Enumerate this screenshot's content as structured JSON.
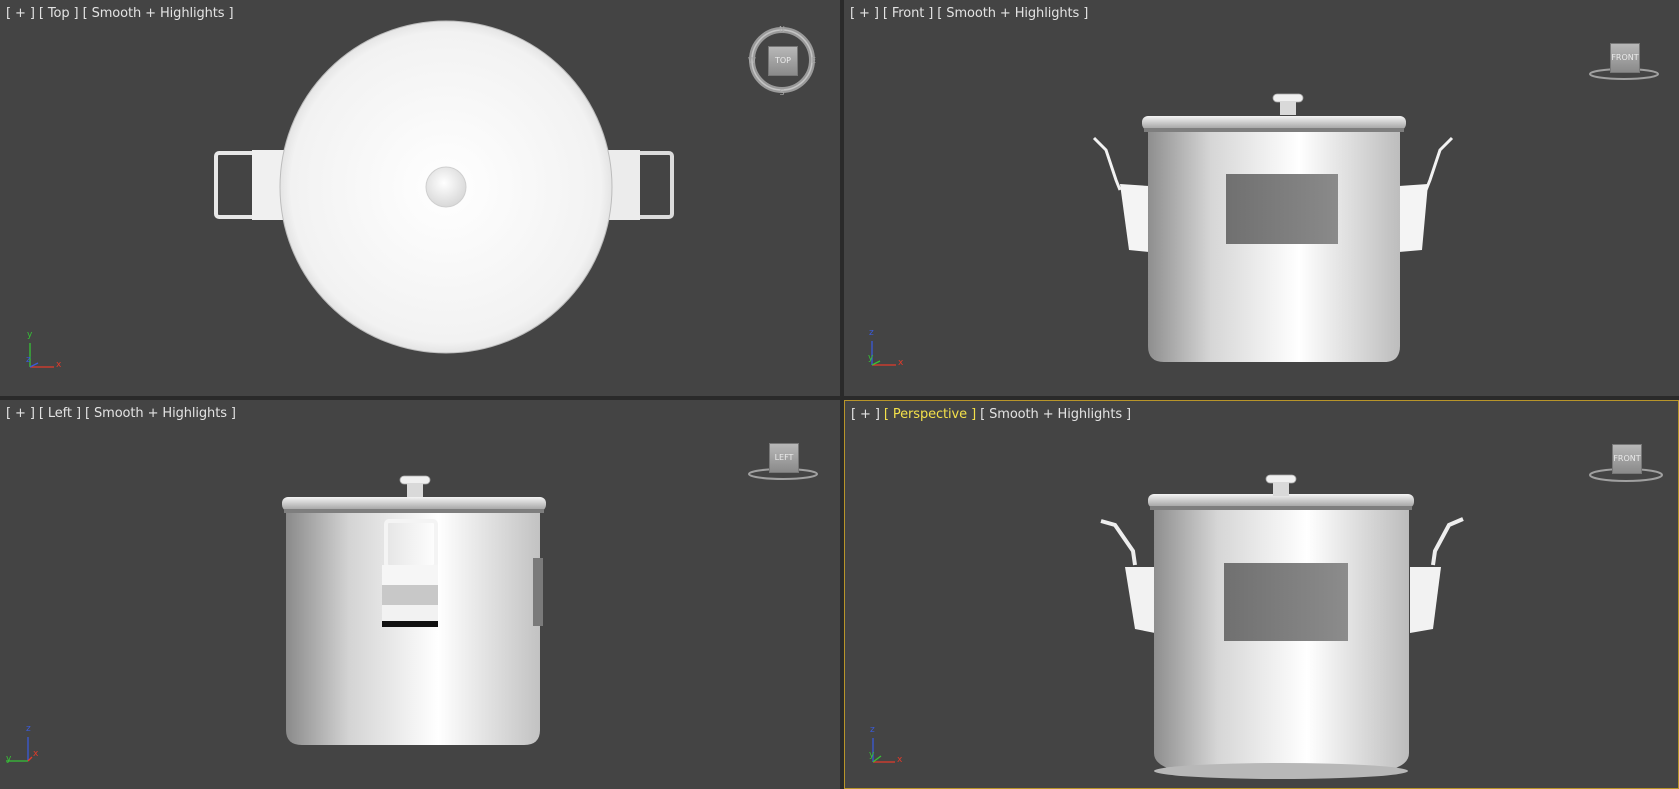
{
  "viewports": [
    {
      "id": "top",
      "menu": "[ + ]",
      "view": "[ Top ]",
      "shading": "[ Smooth + Highlights ]",
      "viewcube": {
        "face": "TOP",
        "compass": [
          "N",
          "E",
          "S",
          "W"
        ]
      },
      "axes": [
        "y",
        "x",
        "z"
      ],
      "active": false
    },
    {
      "id": "front",
      "menu": "[ + ]",
      "view": "[ Front ]",
      "shading": "[ Smooth + Highlights ]",
      "viewcube": {
        "face": "FRONT"
      },
      "axes": [
        "z",
        "x",
        "y"
      ],
      "active": false
    },
    {
      "id": "left",
      "menu": "[ + ]",
      "view": "[ Left ]",
      "shading": "[ Smooth + Highlights ]",
      "viewcube": {
        "face": "LEFT"
      },
      "axes": [
        "z",
        "y",
        "x"
      ],
      "active": false
    },
    {
      "id": "perspective",
      "menu": "[ + ]",
      "view": "[ Perspective ]",
      "shading": "[ Smooth + Highlights ]",
      "viewcube": {
        "face": "FRONT"
      },
      "axes": [
        "z",
        "x",
        "y"
      ],
      "active": true
    }
  ],
  "colors": {
    "viewport_bg": "#444444",
    "active_border": "#b8952a",
    "label_text": "#e3e3e3",
    "active_label": "#f3e04a",
    "axis_x": "#e23a2a",
    "axis_y": "#36c236",
    "axis_z": "#3a5bd8"
  }
}
